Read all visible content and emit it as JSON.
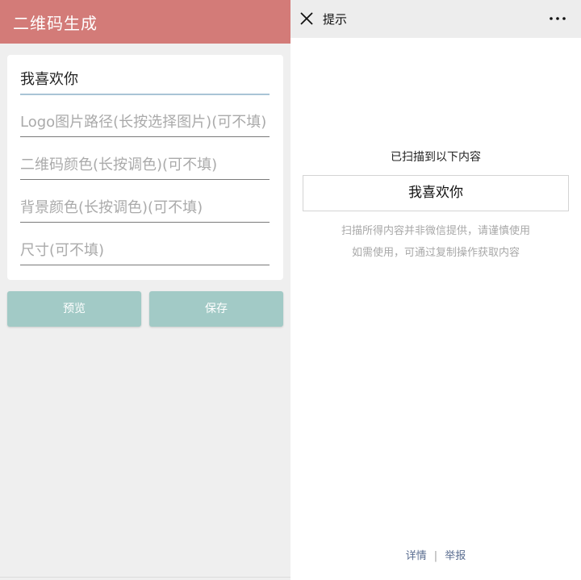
{
  "left": {
    "title": "二维码生成",
    "fields": [
      {
        "value": "我喜欢你",
        "placeholder": ""
      },
      {
        "value": "",
        "placeholder": "Logo图片路径(长按选择图片)(可不填)"
      },
      {
        "value": "",
        "placeholder": "二维码颜色(长按调色)(可不填)"
      },
      {
        "value": "",
        "placeholder": "背景颜色(长按调色)(可不填)"
      },
      {
        "value": "",
        "placeholder": "尺寸(可不填)"
      }
    ],
    "buttons": {
      "preview": "预览",
      "save": "保存"
    },
    "colors": {
      "header": "#d37b78",
      "button": "#a2cac6"
    }
  },
  "right": {
    "title": "提示",
    "icons": {
      "close": "close-icon",
      "more": "more-icon"
    },
    "scan_label": "已扫描到以下内容",
    "result": "我喜欢你",
    "disclaimer": [
      "扫描所得内容并非微信提供，请谨慎使用",
      "如需使用，可通过复制操作获取内容"
    ],
    "footer": {
      "details": "详情",
      "separator": "|",
      "report": "举报"
    }
  }
}
